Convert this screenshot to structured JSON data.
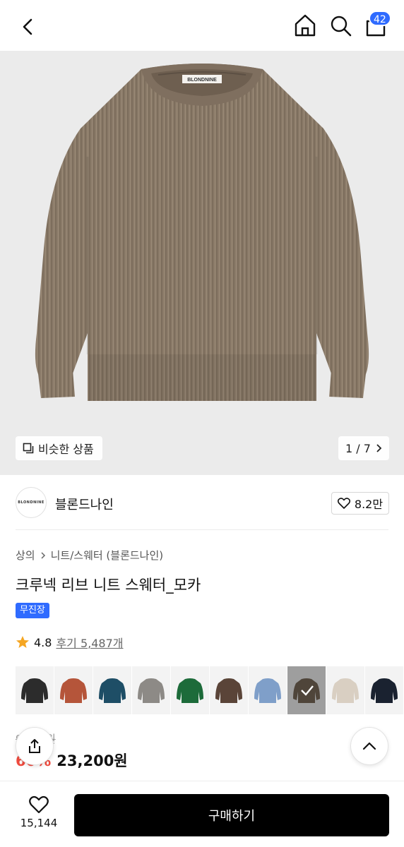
{
  "header": {
    "cart_count": "42"
  },
  "gallery": {
    "similar_label": "비슷한 상품",
    "pager": "1 / 7",
    "sweater_tag": "BLONDNINE"
  },
  "brand": {
    "logo_text": "BLONDNINE",
    "name": "블론드나인",
    "likes": "8.2만"
  },
  "product": {
    "breadcrumb": [
      "상의",
      "니트/스웨터 (블론드나인)"
    ],
    "title": "크루넥 리브 니트 스웨터_모카",
    "store_badge": "무진장",
    "rating": "4.8",
    "reviews": "후기 5,487개"
  },
  "swatches": [
    {
      "name": "black",
      "color": "#2c2c2c"
    },
    {
      "name": "rust",
      "color": "#b5553a"
    },
    {
      "name": "teal",
      "color": "#1e4e66"
    },
    {
      "name": "gray",
      "color": "#8d8a86"
    },
    {
      "name": "green",
      "color": "#1d6b3a"
    },
    {
      "name": "brown",
      "color": "#5a4438"
    },
    {
      "name": "sky",
      "color": "#7f9fc9"
    },
    {
      "name": "mocha",
      "color": "#7a6a5a",
      "selected": true
    },
    {
      "name": "oatmeal",
      "color": "#d9cfc2"
    },
    {
      "name": "navy",
      "color": "#1a2230"
    }
  ],
  "price": {
    "original": "9,000원",
    "discount": "60%",
    "current": "23,200원"
  },
  "bottom": {
    "wish_count": "15,144",
    "buy_label": "구매하기"
  },
  "colors": {
    "accent": "#2f6bff",
    "discount": "#f04b3e",
    "star": "#f5a623",
    "sweater": "#8a7a68"
  }
}
